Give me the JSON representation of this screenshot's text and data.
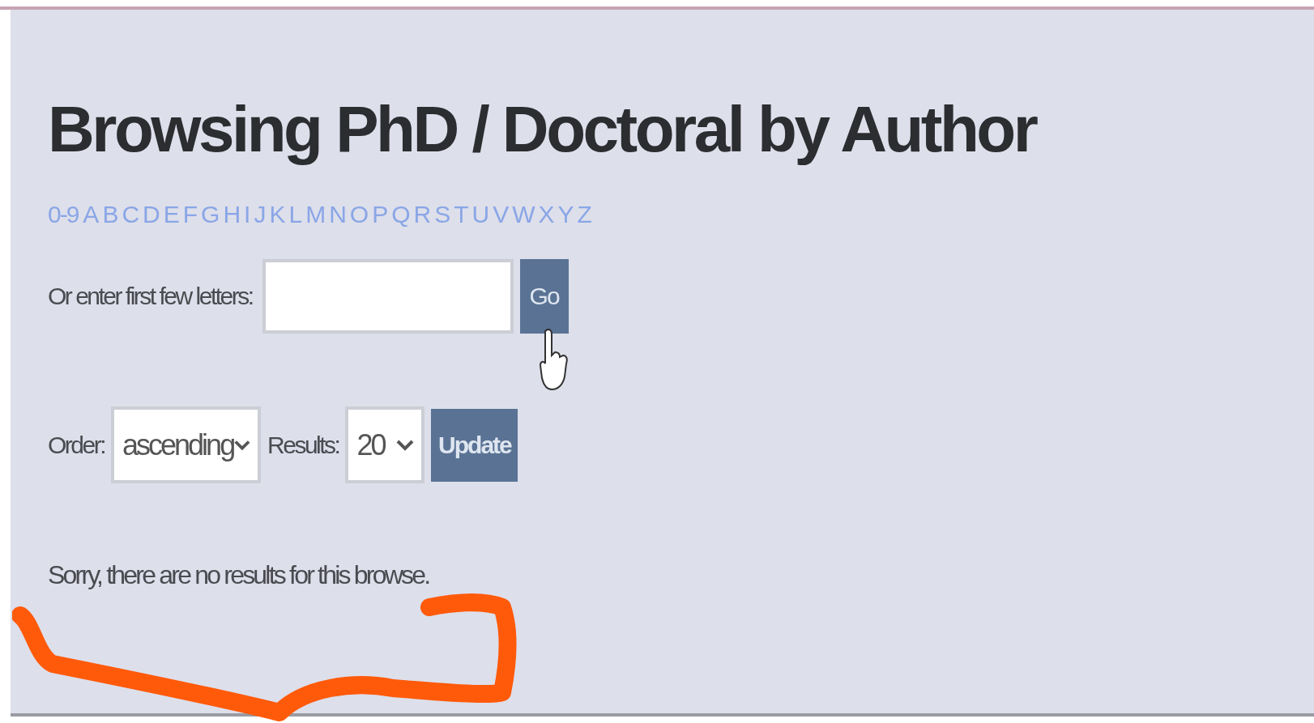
{
  "heading": "Browsing PhD / Doctoral by Author",
  "jump_links": [
    "0-9",
    "A",
    "B",
    "C",
    "D",
    "E",
    "F",
    "G",
    "H",
    "I",
    "J",
    "K",
    "L",
    "M",
    "N",
    "O",
    "P",
    "Q",
    "R",
    "S",
    "T",
    "U",
    "V",
    "W",
    "X",
    "Y",
    "Z"
  ],
  "starts_with": {
    "label": "Or enter first few letters:",
    "button": "Go"
  },
  "controls": {
    "order_label": "Order:",
    "order_value": "ascending",
    "results_label": "Results:",
    "results_value": "20",
    "button": "Update"
  },
  "message": "Sorry, there are no results for this browse."
}
